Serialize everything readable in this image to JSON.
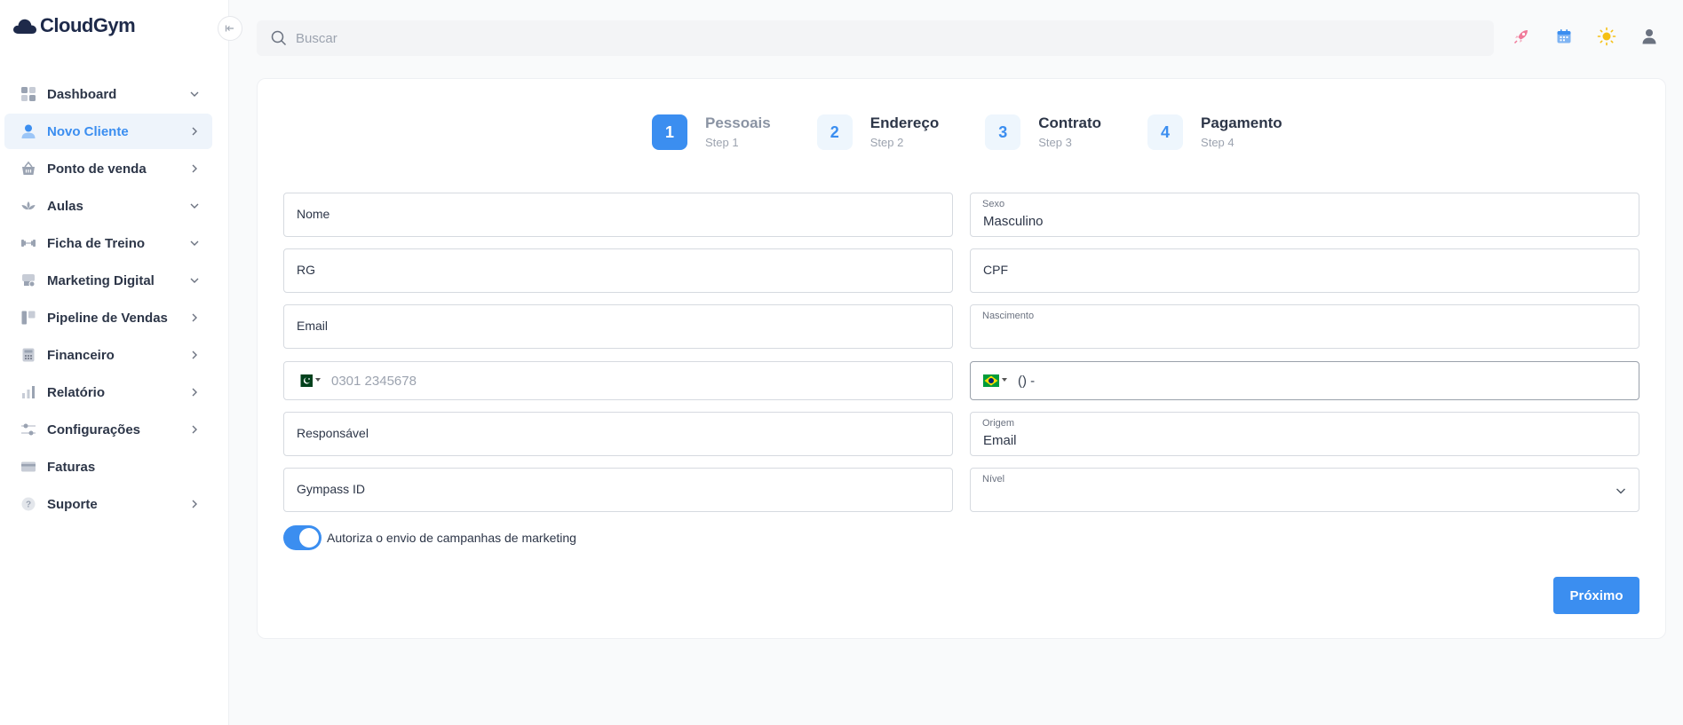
{
  "app": {
    "logo": "CloudGym"
  },
  "sidebar": {
    "items": [
      {
        "label": "Dashboard",
        "icon": "dashboard-icon",
        "chevron": "down"
      },
      {
        "label": "Novo Cliente",
        "icon": "user-icon",
        "chevron": "right",
        "active": true
      },
      {
        "label": "Ponto de venda",
        "icon": "basket-icon",
        "chevron": "right"
      },
      {
        "label": "Aulas",
        "icon": "lotus-icon",
        "chevron": "down"
      },
      {
        "label": "Ficha de Treino",
        "icon": "dumbbell-icon",
        "chevron": "down"
      },
      {
        "label": "Marketing Digital",
        "icon": "megaphone-icon",
        "chevron": "down"
      },
      {
        "label": "Pipeline de Vendas",
        "icon": "pipeline-icon",
        "chevron": "right"
      },
      {
        "label": "Financeiro",
        "icon": "calculator-icon",
        "chevron": "right"
      },
      {
        "label": "Relatório",
        "icon": "bar-chart-icon",
        "chevron": "right"
      },
      {
        "label": "Configurações",
        "icon": "sliders-icon",
        "chevron": "right"
      },
      {
        "label": "Faturas",
        "icon": "credit-card-icon",
        "chevron": "none"
      },
      {
        "label": "Suporte",
        "icon": "help-icon",
        "chevron": "right"
      }
    ]
  },
  "topbar": {
    "search_placeholder": "Buscar",
    "icons": [
      "rocket-icon",
      "calendar-icon",
      "sun-icon",
      "user-profile-icon"
    ]
  },
  "steps": [
    {
      "num": "1",
      "title": "Pessoais",
      "sub": "Step 1",
      "active": true
    },
    {
      "num": "2",
      "title": "Endereço",
      "sub": "Step 2"
    },
    {
      "num": "3",
      "title": "Contrato",
      "sub": "Step 3"
    },
    {
      "num": "4",
      "title": "Pagamento",
      "sub": "Step 4"
    }
  ],
  "form": {
    "nome_placeholder": "Nome",
    "sexo_label": "Sexo",
    "sexo_value": "Masculino",
    "rg_placeholder": "RG",
    "cpf_placeholder": "CPF",
    "email_placeholder": "Email",
    "nascimento_label": "Nascimento",
    "phone1_placeholder": "0301 2345678",
    "phone2_value": "() -",
    "responsavel_placeholder": "Responsável",
    "origem_label": "Origem",
    "origem_value": "Email",
    "gympass_placeholder": "Gympass ID",
    "nivel_label": "Nível",
    "toggle_label": "Autoriza o envio de campanhas de marketing",
    "toggle_on": true,
    "next_label": "Próximo"
  },
  "colors": {
    "accent": "#3b8ef0",
    "text": "#2d3648",
    "border": "#d6dae0"
  }
}
